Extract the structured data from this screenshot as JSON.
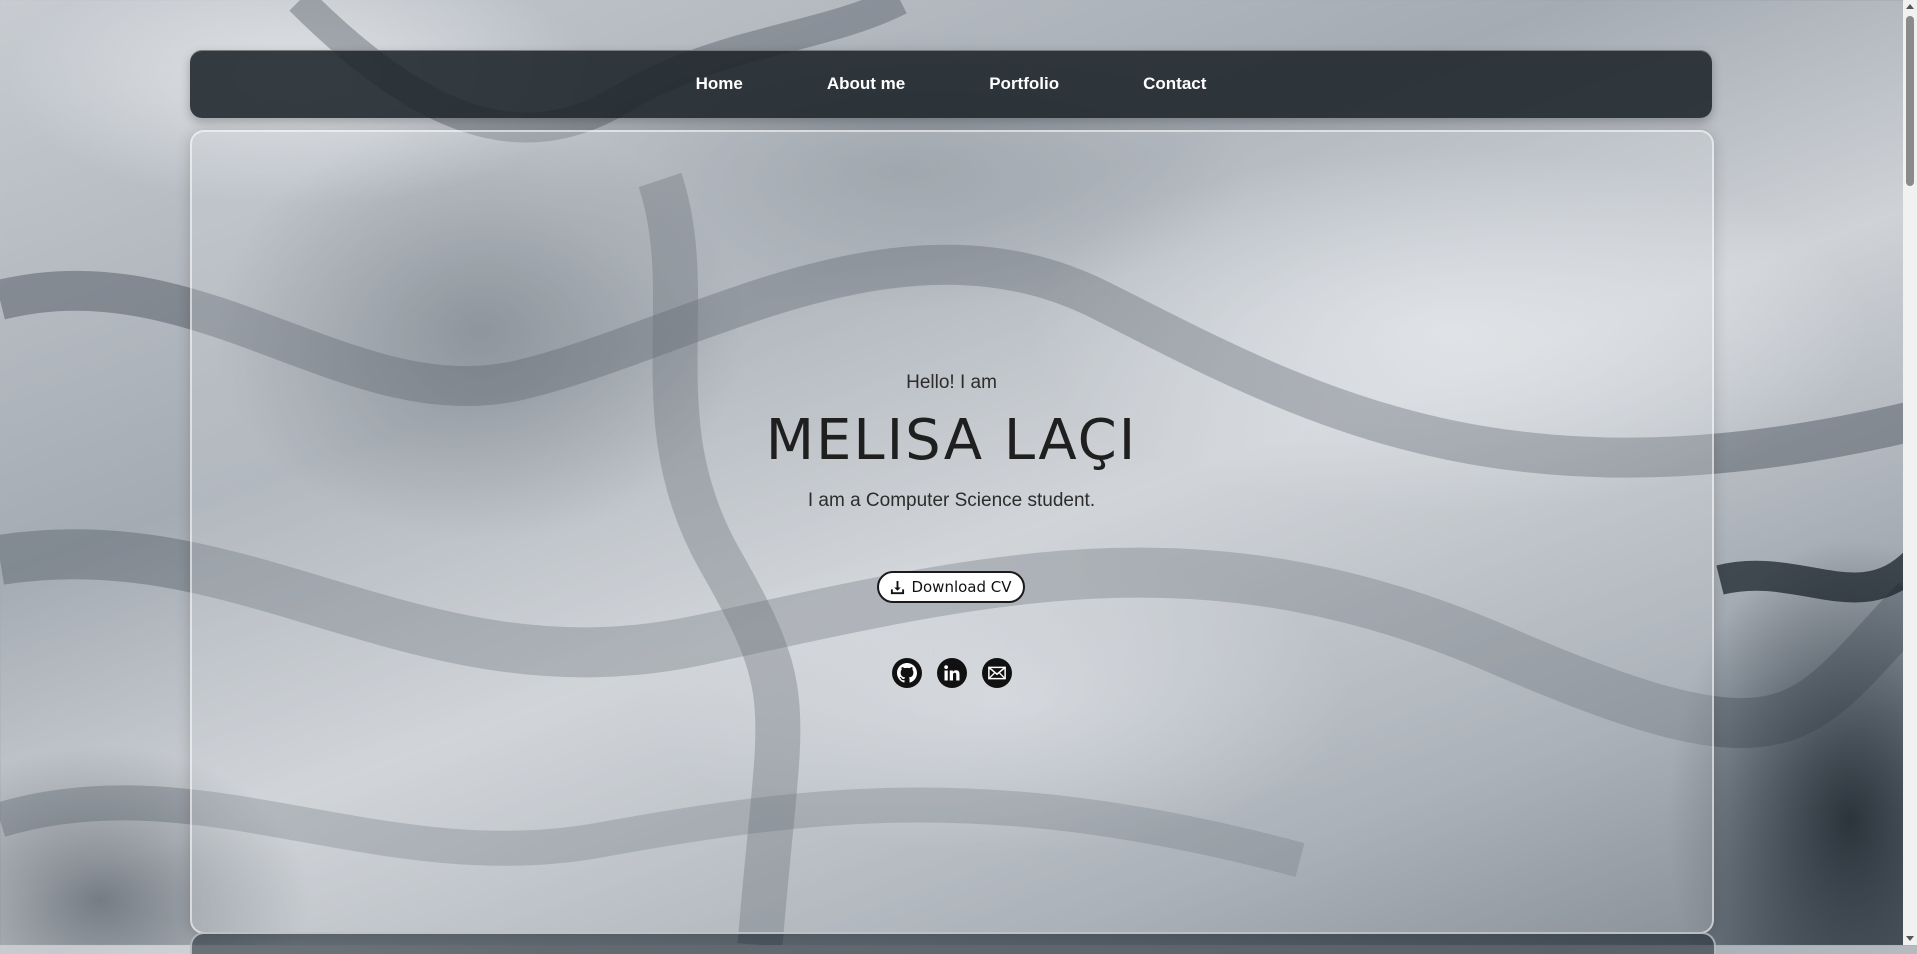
{
  "nav": {
    "items": [
      {
        "label": "Home"
      },
      {
        "label": "About me"
      },
      {
        "label": "Portfolio"
      },
      {
        "label": "Contact"
      }
    ]
  },
  "hero": {
    "greeting": "Hello! I am",
    "name": "MELISA LAÇI",
    "tagline": "I am a Computer Science student.",
    "cv_button_label": "Download CV"
  },
  "socials": [
    {
      "icon": "github-icon"
    },
    {
      "icon": "linkedin-icon"
    },
    {
      "icon": "mail-icon"
    }
  ],
  "colors": {
    "navbar_bg": "#1c242a",
    "text_dark": "#1f1f1f",
    "button_bg": "#ffffff"
  }
}
